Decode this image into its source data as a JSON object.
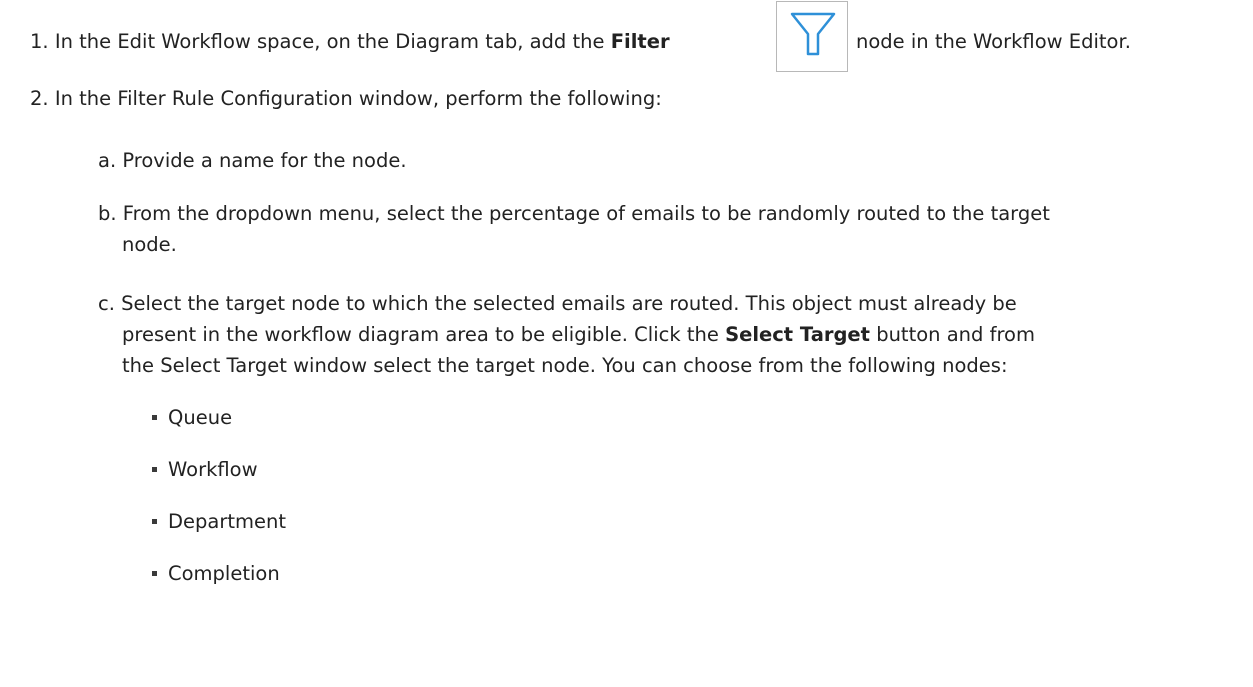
{
  "steps": [
    {
      "number": "1.",
      "text_before": "In the Edit Workflow space, on the Diagram tab, add the",
      "bold": "Filter",
      "icon": "filter-funnel-icon",
      "text_after": "node in the Workflow Editor."
    },
    {
      "number": "2.",
      "text": "In the Filter Rule Configuration window, perform the following:",
      "substeps": [
        {
          "letter": "a.",
          "text": "Provide a name for the node."
        },
        {
          "letter": "b.",
          "line1": "From the dropdown menu, select the percentage of emails to be randomly routed to the target",
          "line2": "node."
        },
        {
          "letter": "c.",
          "line1": "Select the target node to which the selected emails are routed. This object must already be",
          "line2_before": "present in the workflow diagram area to be eligible. Click the",
          "line2_bold": "Select Target",
          "line2_after": "button and from",
          "line3": "the Select Target window select the target node. You can choose from the following nodes:",
          "nodes": [
            "Queue",
            "Workflow",
            "Department",
            "Completion"
          ]
        }
      ]
    }
  ],
  "colors": {
    "text": "#222222",
    "icon_stroke": "#2e90d8",
    "icon_border": "#b8b8b8"
  }
}
